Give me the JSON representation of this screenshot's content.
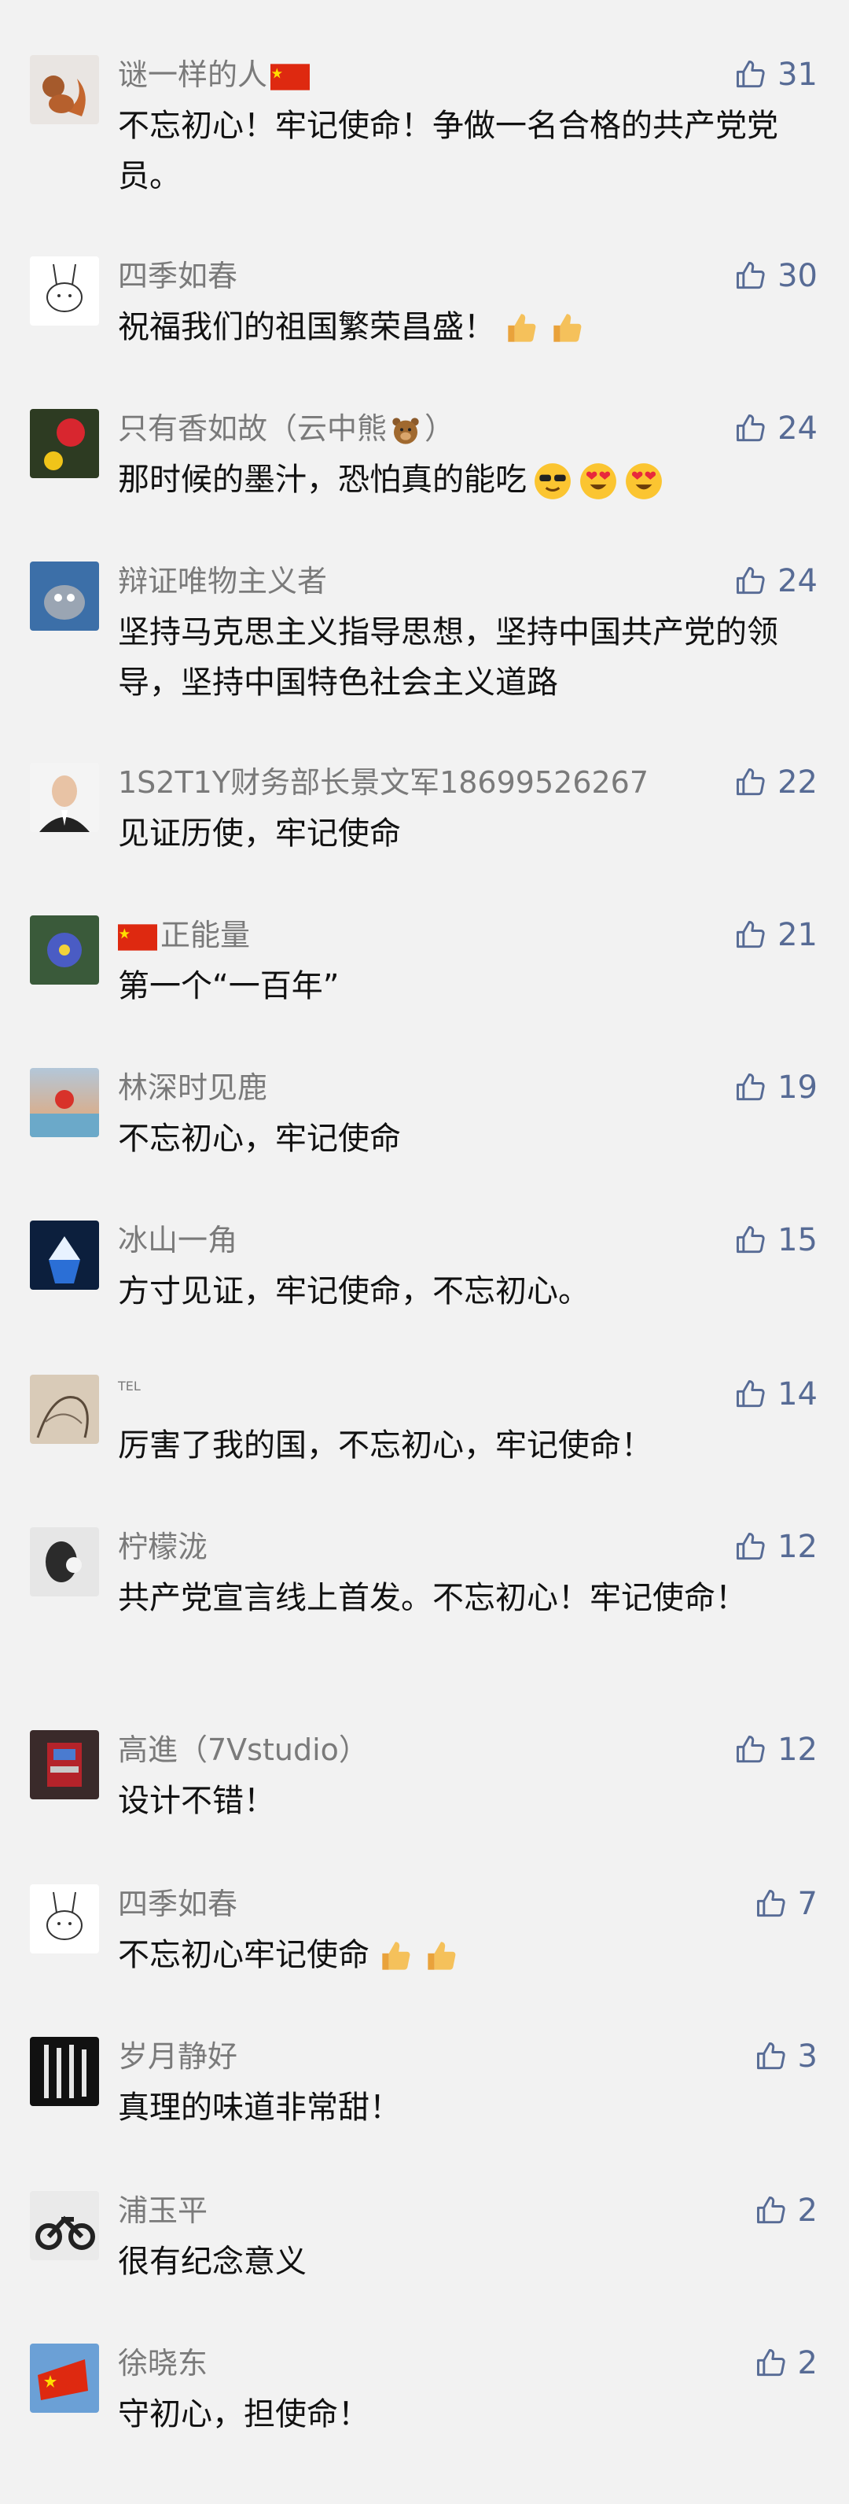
{
  "comments": [
    {
      "name": "谜一样的人",
      "name_suffix_icon": "china-flag-icon",
      "likes": "31",
      "text": "不忘初心！牢记使命！争做一名合格的共产党党员。",
      "emojis": [],
      "avatar": "squirrel-avatar"
    },
    {
      "name": "四季如春",
      "likes": "30",
      "text": "祝福我们的祖国繁荣昌盛！",
      "emojis": [
        "thumbs-up-emoji",
        "thumbs-up-emoji"
      ],
      "avatar": "rabbit-avatar"
    },
    {
      "name": "只有香如故（云中熊",
      "name_suffix_icon": "bear-emoji",
      "name_after": "）",
      "likes": "24",
      "text": "那时候的墨汁，恐怕真的能吃",
      "emojis": [
        "sunglasses-emoji",
        "heart-eyes-emoji",
        "heart-eyes-emoji"
      ],
      "avatar": "flower-avatar"
    },
    {
      "name": "辩证唯物主义者",
      "likes": "24",
      "text": "坚持马克思主义指导思想，坚持中国共产党的领导，坚持中国特色社会主义道路",
      "emojis": [],
      "avatar": "cartoon-avatar"
    },
    {
      "name": "1S2T1Y财务部长景文军18699526267",
      "likes": "22",
      "text": "见证历使，牢记使命",
      "emojis": [],
      "avatar": "man-avatar"
    },
    {
      "name": "正能量",
      "name_prefix_icon": "china-flag-icon",
      "likes": "21",
      "text": "第一个“一百年”",
      "emojis": [],
      "avatar": "blue-flower-avatar"
    },
    {
      "name": "林深时见鹿",
      "likes": "19",
      "text": "不忘初心，牢记使命",
      "emojis": [],
      "avatar": "sunset-avatar"
    },
    {
      "name": "冰山一角",
      "likes": "15",
      "text": "方寸见证，牢记使命，不忘初心。",
      "emojis": [],
      "avatar": "iceberg-avatar"
    },
    {
      "name": "TEL",
      "likes": "14",
      "text": "厉害了我的国，不忘初心，牢记使命！",
      "emojis": [],
      "avatar": "sketch-avatar"
    },
    {
      "name": "柠檬泷",
      "likes": "12",
      "text": "共产党宣言线上首发。不忘初心！牢记使命！",
      "emojis": [],
      "avatar": "dark-avatar"
    },
    {
      "name": "高進（7Vstudio）",
      "likes": "12",
      "text": "设计不错！",
      "emojis": [],
      "avatar": "robot-avatar"
    },
    {
      "name": "四季如春",
      "likes": "7",
      "text": "不忘初心牢记使命",
      "emojis": [
        "thumbs-up-emoji",
        "thumbs-up-emoji"
      ],
      "avatar": "rabbit-avatar"
    },
    {
      "name": "岁月静好",
      "likes": "3",
      "text": "真理的味道非常甜！",
      "emojis": [],
      "avatar": "scroll-avatar"
    },
    {
      "name": "浦玉平",
      "likes": "2",
      "text": "很有纪念意义",
      "emojis": [],
      "avatar": "motorcycle-avatar"
    },
    {
      "name": "徐晓东",
      "likes": "2",
      "text": "守初心，担使命！",
      "emojis": [],
      "avatar": "flag-avatar"
    }
  ],
  "colors": {
    "background": "#f2f2f2",
    "like": "#576b95",
    "name": "#7a7a7a",
    "text": "#111111"
  }
}
